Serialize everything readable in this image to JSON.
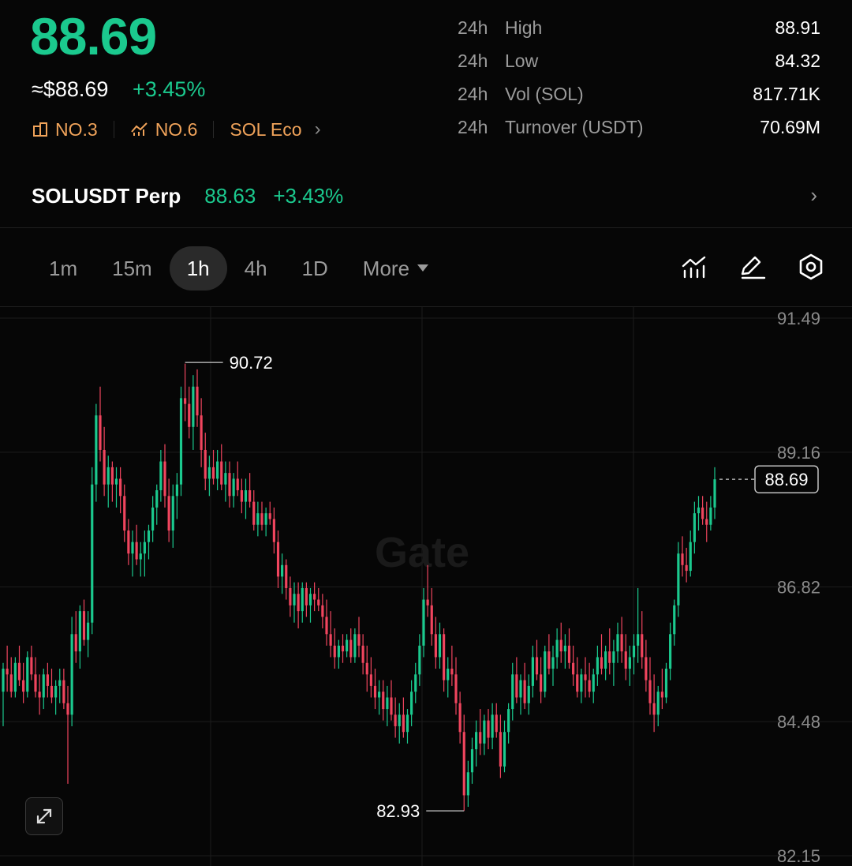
{
  "header": {
    "price": "88.69",
    "usd_price": "≈$88.69",
    "change": "+3.45%",
    "ranks": [
      {
        "icon": "market-cap-rank-icon",
        "label": "NO.3"
      },
      {
        "icon": "trending-rank-icon",
        "label": "NO.6"
      }
    ],
    "ecosystem": "SOL Eco"
  },
  "stats": [
    {
      "period": "24h",
      "label": "High",
      "value": "88.91"
    },
    {
      "period": "24h",
      "label": "Low",
      "value": "84.32"
    },
    {
      "period": "24h",
      "label": "Vol (SOL)",
      "value": "817.71K"
    },
    {
      "period": "24h",
      "label": "Turnover (USDT)",
      "value": "70.69M"
    }
  ],
  "perp": {
    "name": "SOLUSDT Perp",
    "price": "88.63",
    "change": "+3.43%"
  },
  "timeframes": [
    "1m",
    "15m",
    "1h",
    "4h",
    "1D"
  ],
  "active_timeframe": "1h",
  "more_label": "More",
  "tool_icons": [
    "indicator-chart-icon",
    "draw-pen-icon",
    "settings-hexagon-icon"
  ],
  "colors": {
    "up": "#1bc98e",
    "down": "#f0455e",
    "rank": "#f0a35a"
  },
  "watermark": "Gate",
  "chart_data": {
    "type": "candlestick",
    "timeframe": "1h",
    "yticks": [
      91.49,
      89.16,
      86.82,
      84.48,
      82.15
    ],
    "ylim": [
      82.15,
      91.49
    ],
    "high_marker": 90.72,
    "low_marker": 82.93,
    "last_price": 88.69,
    "grid": true,
    "candles": [
      [
        85.0,
        85.5,
        84.4,
        85.4
      ],
      [
        85.4,
        85.8,
        85.0,
        85.3
      ],
      [
        85.3,
        85.6,
        84.9,
        85.0
      ],
      [
        85.0,
        85.6,
        84.9,
        85.5
      ],
      [
        85.5,
        85.8,
        85.1,
        85.2
      ],
      [
        85.2,
        85.5,
        84.8,
        85.0
      ],
      [
        85.0,
        85.7,
        84.9,
        85.6
      ],
      [
        85.6,
        85.8,
        85.2,
        85.3
      ],
      [
        85.3,
        85.6,
        84.9,
        85.0
      ],
      [
        85.0,
        85.3,
        84.6,
        84.9
      ],
      [
        84.9,
        85.4,
        84.7,
        85.3
      ],
      [
        85.3,
        85.5,
        84.9,
        85.1
      ],
      [
        85.1,
        85.4,
        84.8,
        84.9
      ],
      [
        84.9,
        85.2,
        84.6,
        85.1
      ],
      [
        85.1,
        85.4,
        84.8,
        85.2
      ],
      [
        85.2,
        85.4,
        84.7,
        84.8
      ],
      [
        84.8,
        85.1,
        83.4,
        84.6
      ],
      [
        84.6,
        86.3,
        84.4,
        86.0
      ],
      [
        86.0,
        86.4,
        85.5,
        85.7
      ],
      [
        85.7,
        86.5,
        85.4,
        86.4
      ],
      [
        86.4,
        86.6,
        85.8,
        85.9
      ],
      [
        85.9,
        86.4,
        85.6,
        86.2
      ],
      [
        86.2,
        88.9,
        86.0,
        88.6
      ],
      [
        88.6,
        90.0,
        88.3,
        89.8
      ],
      [
        89.8,
        90.3,
        89.0,
        89.2
      ],
      [
        89.2,
        89.6,
        88.4,
        88.6
      ],
      [
        88.6,
        89.1,
        88.2,
        88.9
      ],
      [
        88.9,
        89.0,
        88.3,
        88.6
      ],
      [
        88.6,
        88.9,
        88.2,
        88.7
      ],
      [
        88.7,
        88.9,
        88.1,
        88.4
      ],
      [
        88.4,
        88.6,
        87.6,
        87.8
      ],
      [
        87.8,
        88.0,
        87.2,
        87.4
      ],
      [
        87.4,
        87.8,
        87.0,
        87.6
      ],
      [
        87.6,
        87.9,
        87.2,
        87.3
      ],
      [
        87.3,
        87.6,
        87.0,
        87.4
      ],
      [
        87.4,
        87.8,
        87.0,
        87.6
      ],
      [
        87.6,
        87.9,
        87.3,
        87.8
      ],
      [
        87.8,
        88.4,
        87.6,
        88.2
      ],
      [
        88.2,
        88.6,
        87.9,
        88.5
      ],
      [
        88.5,
        89.2,
        88.3,
        89.0
      ],
      [
        89.0,
        89.3,
        88.2,
        88.4
      ],
      [
        88.4,
        88.7,
        87.6,
        87.8
      ],
      [
        87.8,
        88.6,
        87.5,
        88.4
      ],
      [
        88.4,
        88.8,
        88.0,
        88.6
      ],
      [
        88.6,
        90.3,
        88.4,
        90.1
      ],
      [
        90.1,
        90.7,
        89.7,
        90.0
      ],
      [
        90.0,
        90.3,
        89.4,
        89.6
      ],
      [
        89.6,
        90.5,
        89.2,
        90.3
      ],
      [
        90.3,
        90.6,
        89.6,
        89.8
      ],
      [
        89.8,
        90.1,
        88.9,
        89.2
      ],
      [
        89.2,
        89.5,
        88.5,
        88.7
      ],
      [
        88.7,
        89.1,
        88.4,
        88.9
      ],
      [
        88.9,
        89.2,
        88.6,
        88.7
      ],
      [
        88.7,
        89.2,
        88.5,
        89.0
      ],
      [
        89.0,
        89.3,
        88.5,
        88.6
      ],
      [
        88.6,
        89.0,
        88.3,
        88.8
      ],
      [
        88.8,
        89.0,
        88.2,
        88.4
      ],
      [
        88.4,
        88.8,
        88.2,
        88.7
      ],
      [
        88.7,
        89.0,
        88.4,
        88.5
      ],
      [
        88.5,
        88.7,
        88.1,
        88.3
      ],
      [
        88.3,
        88.7,
        88.0,
        88.5
      ],
      [
        88.5,
        88.8,
        88.2,
        88.3
      ],
      [
        88.3,
        88.5,
        87.8,
        87.9
      ],
      [
        87.9,
        88.3,
        87.7,
        88.1
      ],
      [
        88.1,
        88.3,
        87.8,
        87.9
      ],
      [
        87.9,
        88.2,
        87.7,
        88.1
      ],
      [
        88.1,
        88.3,
        87.9,
        88.0
      ],
      [
        88.0,
        88.2,
        87.4,
        87.6
      ],
      [
        87.6,
        87.8,
        86.8,
        87.0
      ],
      [
        87.0,
        87.4,
        86.7,
        87.2
      ],
      [
        87.2,
        87.3,
        86.6,
        86.8
      ],
      [
        86.8,
        87.0,
        86.3,
        86.5
      ],
      [
        86.5,
        86.9,
        86.2,
        86.7
      ],
      [
        86.7,
        86.9,
        86.1,
        86.4
      ],
      [
        86.4,
        86.9,
        86.2,
        86.8
      ],
      [
        86.8,
        86.9,
        86.3,
        86.5
      ],
      [
        86.5,
        86.8,
        86.2,
        86.7
      ],
      [
        86.7,
        86.9,
        86.4,
        86.6
      ],
      [
        86.6,
        86.8,
        86.4,
        86.5
      ],
      [
        86.5,
        86.7,
        86.1,
        86.3
      ],
      [
        86.3,
        86.6,
        85.8,
        86.0
      ],
      [
        86.0,
        86.4,
        85.6,
        85.8
      ],
      [
        85.8,
        86.1,
        85.4,
        85.6
      ],
      [
        85.6,
        85.9,
        85.4,
        85.8
      ],
      [
        85.8,
        86.0,
        85.5,
        85.7
      ],
      [
        85.7,
        86.0,
        85.6,
        85.9
      ],
      [
        85.9,
        86.1,
        85.5,
        85.6
      ],
      [
        85.6,
        86.1,
        85.5,
        86.0
      ],
      [
        86.0,
        86.3,
        85.6,
        85.8
      ],
      [
        85.8,
        86.0,
        85.3,
        85.5
      ],
      [
        85.5,
        85.8,
        85.0,
        85.3
      ],
      [
        85.3,
        85.6,
        84.9,
        85.1
      ],
      [
        85.1,
        85.4,
        84.7,
        84.9
      ],
      [
        84.9,
        85.2,
        84.6,
        85.0
      ],
      [
        85.0,
        85.2,
        84.5,
        84.7
      ],
      [
        84.7,
        85.1,
        84.4,
        84.9
      ],
      [
        84.9,
        85.2,
        84.5,
        84.6
      ],
      [
        84.6,
        84.9,
        84.2,
        84.4
      ],
      [
        84.4,
        84.8,
        84.1,
        84.6
      ],
      [
        84.6,
        84.9,
        84.2,
        84.3
      ],
      [
        84.3,
        84.7,
        84.1,
        84.6
      ],
      [
        84.6,
        85.2,
        84.4,
        85.0
      ],
      [
        85.0,
        85.5,
        84.8,
        85.3
      ],
      [
        85.3,
        86.0,
        85.1,
        85.8
      ],
      [
        85.8,
        86.8,
        85.6,
        86.6
      ],
      [
        86.6,
        87.2,
        86.3,
        86.5
      ],
      [
        86.5,
        86.8,
        85.8,
        86.0
      ],
      [
        86.0,
        86.3,
        85.4,
        85.6
      ],
      [
        85.6,
        86.2,
        85.4,
        86.0
      ],
      [
        86.0,
        86.1,
        85.0,
        85.2
      ],
      [
        85.2,
        85.6,
        84.9,
        85.4
      ],
      [
        85.4,
        85.8,
        85.1,
        85.3
      ],
      [
        85.3,
        85.6,
        84.6,
        84.8
      ],
      [
        84.8,
        85.0,
        84.1,
        84.3
      ],
      [
        84.3,
        84.6,
        82.93,
        83.2
      ],
      [
        83.2,
        83.8,
        83.0,
        83.6
      ],
      [
        83.6,
        84.2,
        83.4,
        84.0
      ],
      [
        84.0,
        84.5,
        83.7,
        84.3
      ],
      [
        84.3,
        84.7,
        83.9,
        84.1
      ],
      [
        84.1,
        84.6,
        83.9,
        84.5
      ],
      [
        84.5,
        84.7,
        84.0,
        84.2
      ],
      [
        84.2,
        84.8,
        84.0,
        84.6
      ],
      [
        84.6,
        84.8,
        84.2,
        84.3
      ],
      [
        84.3,
        84.6,
        83.5,
        83.7
      ],
      [
        83.7,
        84.5,
        83.6,
        84.3
      ],
      [
        84.3,
        84.8,
        84.1,
        84.7
      ],
      [
        84.7,
        85.5,
        84.5,
        85.3
      ],
      [
        85.3,
        85.6,
        84.8,
        84.9
      ],
      [
        84.9,
        85.3,
        84.6,
        85.2
      ],
      [
        85.2,
        85.5,
        84.7,
        84.8
      ],
      [
        84.8,
        85.3,
        84.6,
        85.1
      ],
      [
        85.1,
        85.8,
        84.9,
        85.6
      ],
      [
        85.6,
        85.9,
        85.2,
        85.3
      ],
      [
        85.3,
        85.6,
        84.8,
        85.0
      ],
      [
        85.0,
        85.8,
        84.9,
        85.7
      ],
      [
        85.7,
        86.0,
        85.3,
        85.4
      ],
      [
        85.4,
        85.8,
        85.1,
        85.6
      ],
      [
        85.6,
        86.1,
        85.4,
        85.9
      ],
      [
        85.9,
        86.2,
        85.5,
        85.7
      ],
      [
        85.7,
        86.0,
        85.4,
        85.8
      ],
      [
        85.8,
        86.1,
        85.4,
        85.5
      ],
      [
        85.5,
        85.8,
        85.1,
        85.3
      ],
      [
        85.3,
        85.6,
        84.9,
        85.0
      ],
      [
        85.0,
        85.4,
        84.8,
        85.3
      ],
      [
        85.3,
        85.6,
        84.9,
        85.2
      ],
      [
        85.2,
        85.5,
        84.9,
        85.0
      ],
      [
        85.0,
        85.4,
        84.8,
        85.3
      ],
      [
        85.3,
        85.8,
        85.1,
        85.6
      ],
      [
        85.6,
        86.0,
        85.3,
        85.4
      ],
      [
        85.4,
        85.8,
        85.2,
        85.7
      ],
      [
        85.7,
        86.1,
        85.3,
        85.5
      ],
      [
        85.5,
        85.9,
        85.1,
        85.7
      ],
      [
        85.7,
        86.2,
        85.5,
        86.0
      ],
      [
        86.0,
        86.3,
        85.5,
        85.7
      ],
      [
        85.7,
        86.0,
        85.2,
        85.4
      ],
      [
        85.4,
        85.8,
        85.1,
        85.6
      ],
      [
        85.6,
        86.0,
        85.3,
        85.8
      ],
      [
        85.8,
        86.8,
        85.5,
        86.0
      ],
      [
        86.0,
        86.4,
        85.4,
        85.6
      ],
      [
        85.6,
        85.9,
        85.0,
        85.2
      ],
      [
        85.2,
        85.6,
        84.6,
        84.8
      ],
      [
        84.8,
        85.3,
        84.3,
        84.6
      ],
      [
        84.6,
        85.1,
        84.4,
        85.0
      ],
      [
        85.0,
        85.4,
        84.7,
        84.9
      ],
      [
        84.9,
        85.5,
        84.8,
        85.4
      ],
      [
        85.4,
        86.2,
        85.2,
        86.0
      ],
      [
        86.0,
        86.6,
        85.8,
        86.5
      ],
      [
        86.5,
        87.6,
        86.3,
        87.4
      ],
      [
        87.4,
        87.7,
        87.0,
        87.2
      ],
      [
        87.2,
        87.5,
        86.9,
        87.1
      ],
      [
        87.1,
        87.8,
        87.0,
        87.6
      ],
      [
        87.6,
        88.3,
        87.4,
        88.1
      ],
      [
        88.1,
        88.4,
        87.8,
        88.2
      ],
      [
        88.2,
        88.4,
        87.9,
        88.0
      ],
      [
        88.0,
        88.3,
        87.6,
        87.9
      ],
      [
        87.9,
        88.4,
        87.8,
        88.2
      ],
      [
        88.2,
        88.9,
        88.0,
        88.69
      ]
    ]
  }
}
